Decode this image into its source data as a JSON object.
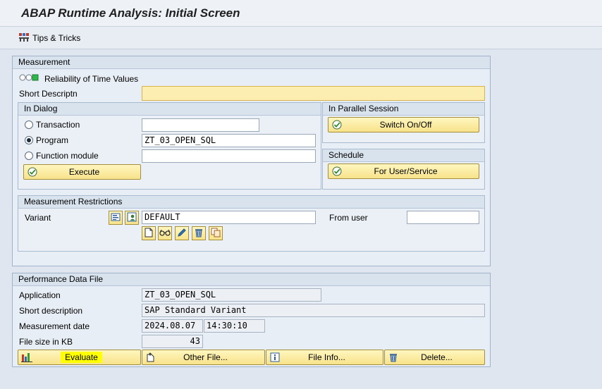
{
  "window": {
    "title": "ABAP Runtime Analysis: Initial Screen"
  },
  "toolbar": {
    "tips_label": "Tips & Tricks"
  },
  "measurement": {
    "group_title": "Measurement",
    "reliability_label": "Reliability of Time Values",
    "short_desc_label": "Short Descriptn",
    "short_desc_value": "",
    "in_dialog": {
      "title": "In Dialog",
      "transaction_label": "Transaction",
      "transaction_value": "",
      "program_label": "Program",
      "program_value": "ZT_03_OPEN_SQL",
      "function_label": "Function module",
      "function_value": "",
      "selected": "program",
      "execute_label": "Execute"
    },
    "parallel": {
      "title": "In Parallel Session",
      "switch_label": "Switch On/Off"
    },
    "schedule": {
      "title": "Schedule",
      "user_service_label": "For User/Service"
    },
    "restrictions": {
      "title": "Measurement Restrictions",
      "variant_label": "Variant",
      "variant_value": "DEFAULT",
      "from_user_label": "From user",
      "from_user_value": ""
    }
  },
  "perf_file": {
    "group_title": "Performance Data File",
    "application_label": "Application",
    "application_value": "ZT_03_OPEN_SQL",
    "short_desc_label": "Short description",
    "short_desc_value": "SAP Standard Variant",
    "date_label": "Measurement date",
    "date_value": "2024.08.07",
    "time_value": "14:30:10",
    "size_label": "File size in KB",
    "size_value": "43",
    "buttons": {
      "evaluate": "Evaluate",
      "other_file": "Other File...",
      "file_info": "File Info...",
      "delete": "Delete..."
    }
  },
  "colors": {
    "button_yellow": "#f7e38a",
    "highlight": "#ffff00",
    "required_field": "#fbeeb0"
  }
}
